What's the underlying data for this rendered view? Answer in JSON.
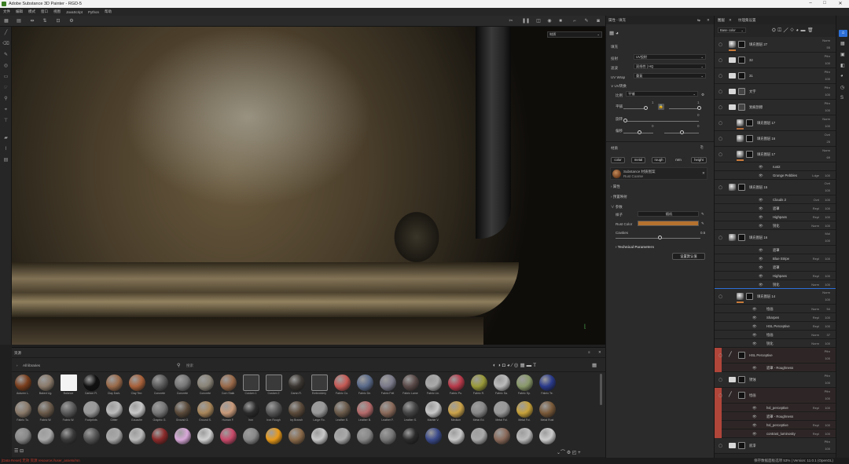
{
  "app": {
    "title": "Adobe Substance 3D Painter - RGD-5",
    "win_controls": [
      "–",
      "□",
      "✕"
    ]
  },
  "menu": [
    "文件",
    "编辑",
    "模式",
    "窗口",
    "视图",
    "JavaScript",
    "Python",
    "帮助"
  ],
  "viewport": {
    "dropdown": "材质"
  },
  "properties": {
    "panel_title": "属性 - 填充",
    "section_fill": "填充",
    "proj_label": "投射",
    "proj_value": "UV投射",
    "filter_label": "滤波",
    "filter_value": "双线性 | HQ",
    "uvwrap_label": "UV Wrap",
    "uvwrap_value": "重复",
    "uv_transform": "UV转换",
    "scale_label": "比例",
    "scale_value": "平铺",
    "tile_label": "平铺",
    "tile_val": "1",
    "rot_label": "旋转",
    "rot_val": "0",
    "offset_label": "偏移",
    "offset_val": "0",
    "section_material": "材质",
    "channels": [
      "color",
      "metal",
      "rough",
      "nrm",
      "height"
    ],
    "material_name": "Substance 材质图案",
    "material_sub": "Rust Coarse",
    "attrs": "属性",
    "tex_map": "预置映射",
    "params": "参数",
    "preset_label": "样子",
    "preset_value": "随机",
    "rust_color_label": "Rust Color",
    "cavities_label": "Cavities",
    "cavities_val": "0.5",
    "tech_params": "Technical Parameters",
    "reset_button": "设置默认值",
    "rust_color": "#b5722f"
  },
  "layers": {
    "tabs": [
      "图层",
      "纹理集设置"
    ],
    "blend_select": "Base color",
    "rows": [
      {
        "name": "填充图层 27",
        "mode": "Norm",
        "op": "55"
      },
      {
        "name": "32",
        "mode": "Pthr",
        "op": "100"
      },
      {
        "name": "31",
        "mode": "Pthr",
        "op": "100"
      },
      {
        "name": "文字",
        "mode": "Pthr",
        "op": "100"
      },
      {
        "name": "划痕刮擦",
        "mode": "Pthr",
        "op": "100"
      },
      {
        "name": "填充图层 17",
        "mode": "Norm",
        "op": "100"
      },
      {
        "name": "填充图层 16",
        "mode": "Ovrl",
        "op": "25"
      },
      {
        "name": "填充图层 17",
        "mode": "Norm",
        "op": "69"
      },
      {
        "name": "rust2",
        "mode": "",
        "op": ""
      },
      {
        "name": "Grunge Pebbles",
        "mode": "Ldge",
        "op": "100"
      },
      {
        "name": "填充图层 15",
        "mode": "Ovrl",
        "op": "100"
      },
      {
        "name": "Clouds 2",
        "mode": "Ovrl",
        "op": "100"
      },
      {
        "name": "遮罩",
        "mode": "Repl",
        "op": "100"
      },
      {
        "name": "Highpass",
        "mode": "Repl",
        "op": "100"
      },
      {
        "name": "锐化",
        "mode": "Norm",
        "op": "100"
      },
      {
        "name": "填充图层 16",
        "mode": "Mul",
        "op": "100"
      },
      {
        "name": "遮罩",
        "mode": "",
        "op": ""
      },
      {
        "name": "Blue Stripe",
        "mode": "Repl",
        "op": "100"
      },
      {
        "name": "遮罩",
        "mode": "",
        "op": ""
      },
      {
        "name": "Highpass",
        "mode": "Repl",
        "op": "100"
      },
      {
        "name": "锐化",
        "mode": "Norm",
        "op": "100"
      },
      {
        "name": "填充图层 14",
        "mode": "Norm",
        "op": "100"
      },
      {
        "name": "绘画",
        "mode": "Norm",
        "op": "54"
      },
      {
        "name": "Sharpen",
        "mode": "Repl",
        "op": "100"
      },
      {
        "name": "HSL Perceptive",
        "mode": "Repl",
        "op": "100"
      },
      {
        "name": "绘画",
        "mode": "Norm",
        "op": "37"
      },
      {
        "name": "锐化",
        "mode": "Norm",
        "op": "100"
      },
      {
        "name": "HSL Perceptive",
        "mode": "Pthr",
        "op": "100"
      },
      {
        "name": "遮罩 - Roughness",
        "mode": "",
        "op": ""
      },
      {
        "name": "锈蚀",
        "mode": "Pthr",
        "op": "100"
      },
      {
        "name": "绘画",
        "mode": "Pthr",
        "op": "100"
      },
      {
        "name": "hsl_perceptive",
        "mode": "Repl",
        "op": "100"
      },
      {
        "name": "遮罩 - Roughness",
        "mode": "",
        "op": ""
      },
      {
        "name": "hsl_perceptive",
        "mode": "Repl",
        "op": "100"
      },
      {
        "name": "contrast_luminosity",
        "mode": "Repl",
        "op": "100"
      },
      {
        "name": "底漆",
        "mode": "Pthr",
        "op": "100"
      }
    ]
  },
  "shelf": {
    "title": "资源",
    "all_label": "All libraries",
    "search": "搜索",
    "row1": [
      "Autumn L.",
      "Baked Lig.",
      "Balance",
      "Carbon Fi.",
      "Clay Dark.",
      "Clay Terr.",
      "Concrete",
      "Concrete",
      "Concrete",
      "Corn Stalk",
      "Custom 1",
      "Custom 2",
      "Damn R.",
      "Embroidery",
      "Fabric Co.",
      "Fabric De.",
      "Fabric Felt",
      "Fabric Lame",
      "Fabric Lin.",
      "Fabric Pu.",
      "Fabric R.",
      "Fabric Sa.",
      "Fabric Sp.",
      "Fabric Te."
    ],
    "row2": [
      "Fabric To.",
      "Fabric W.",
      "Fabric W.",
      "Footprints",
      "Glitter",
      "Gouache",
      "Graphic G.",
      "Ground G.",
      "Ground S.",
      "Human F.",
      "Iron",
      "Iron Rough",
      "Ivy Branch",
      "Large Ro.",
      "Leather S.",
      "Leather B.",
      "Leather F.",
      "Leather S.",
      "Marble V.",
      "Medium",
      "Metal Ed.",
      "Metal Foi.",
      "Metal Foi.",
      "Metal Rust"
    ]
  },
  "status": {
    "left": "[Data Reset] 无效 资源 resource://user_assets/rsn",
    "right": "保存数据面板选项    53% | Version: 11.0.1 (OpenGL)"
  }
}
